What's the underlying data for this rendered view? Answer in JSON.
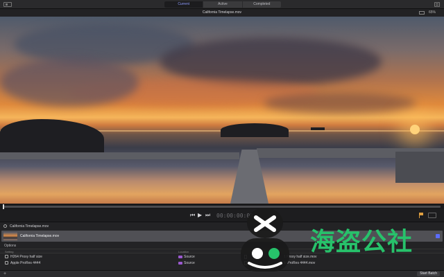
{
  "titlebar": {
    "tabs": [
      {
        "label": "Current",
        "active": true
      },
      {
        "label": "Active",
        "active": false
      },
      {
        "label": "Completed",
        "active": false
      }
    ]
  },
  "viewer": {
    "title": "California Timelapse.mov",
    "zoom": "65%"
  },
  "transport": {
    "timecode": "00:00:00:00"
  },
  "batch": {
    "file_header": "California Timelapse.mov",
    "clip_name": "California Timelapse.mov",
    "options_label": "Options",
    "columns": {
      "setting": "Setting",
      "location": "Location"
    },
    "rows": [
      {
        "setting": "H264 Proxy half size",
        "location": "Source",
        "output": "1 Proxy half size.mov"
      },
      {
        "setting": "Apple ProRes 4444",
        "location": "Source",
        "output": "le ProRes 4444.mov"
      }
    ]
  },
  "bottombar": {
    "add_label": "+",
    "start_label": "Start Batch"
  },
  "watermark": {
    "text": "海盗公社"
  },
  "colors": {
    "accent": "#5b6cff",
    "active_tab_text": "#8f9cff",
    "watermark_green": "#27c26b",
    "folder": "#9b59d0"
  }
}
